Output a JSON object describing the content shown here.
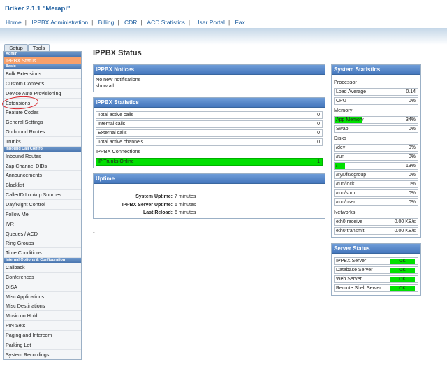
{
  "app": {
    "title": "Briker 2.1.1 \"Merapi\""
  },
  "topnav": {
    "items": [
      "Home",
      "IPPBX Administration",
      "Billing",
      "CDR",
      "ACD Statistics",
      "User Portal",
      "Fax"
    ],
    "separator": "|"
  },
  "sidebar": {
    "tabs": [
      "Setup",
      "Tools"
    ],
    "sections": [
      {
        "header": "Admin",
        "items": [
          "IPPBX Status"
        ]
      },
      {
        "header": "Basic",
        "items": [
          "Bulk Extensions",
          "Custom Contexts",
          "Device Auto Provisioning",
          "Extensions",
          "Feature Codes",
          "General Settings",
          "Outbound Routes",
          "Trunks"
        ]
      },
      {
        "header": "Inbound Call Control",
        "items": [
          "Inbound Routes",
          "Zap Channel DIDs",
          "Announcements",
          "Blacklist",
          "CallerID Lookup Sources",
          "Day/Night Control",
          "Follow Me",
          "IVR",
          "Queues / ACD",
          "Ring Groups",
          "Time Conditions"
        ]
      },
      {
        "header": "Internal Options & Configuration",
        "items": [
          "Callback",
          "Conferences",
          "DISA",
          "Misc Applications",
          "Misc Destinations",
          "Music on Hold",
          "PIN Sets",
          "Paging and Intercom",
          "Parking Lot",
          "System Recordings"
        ]
      }
    ],
    "active_item": "IPPBX Status",
    "highlighted_item": "Extensions"
  },
  "page": {
    "title": "IPPBX Status",
    "footnote": "-"
  },
  "notices": {
    "title": "IPPBX Notices",
    "lines": [
      "No new notifications",
      "show all"
    ]
  },
  "ippbx_stats": {
    "title": "IPPBX Statistics",
    "rows": [
      {
        "label": "Total active calls",
        "value": "0"
      },
      {
        "label": "Internal calls",
        "value": "0"
      },
      {
        "label": "External calls",
        "value": "0"
      },
      {
        "label": "Total active channels",
        "value": "0"
      }
    ],
    "connections_label": "IPPBX Connections",
    "connections": [
      {
        "label": "IP Trunks Online",
        "value": "1"
      }
    ]
  },
  "uptime": {
    "title": "Uptime",
    "rows": [
      {
        "label": "System Uptime:",
        "value": "7 minutes"
      },
      {
        "label": "IPPBX Server Uptime:",
        "value": "6 minutes"
      },
      {
        "label": "Last Reload:",
        "value": "6 minutes"
      }
    ]
  },
  "system_stats": {
    "title": "System Statistics",
    "processor_label": "Processor",
    "processor": [
      {
        "label": "Load Average",
        "value": "0.14"
      },
      {
        "label": "CPU",
        "value": "0%"
      }
    ],
    "memory_label": "Memory",
    "memory": [
      {
        "label": "App Memory",
        "value": "34%",
        "fill": 0.34
      },
      {
        "label": "Swap",
        "value": "0%",
        "fill": 0
      }
    ],
    "disks_label": "Disks",
    "disks": [
      {
        "label": "/dev",
        "value": "0%",
        "fill": 0
      },
      {
        "label": "/run",
        "value": "0%",
        "fill": 0
      },
      {
        "label": "/",
        "value": "13%",
        "fill": 0.13
      },
      {
        "label": "/sys/fs/cgroup",
        "value": "0%",
        "fill": 0
      },
      {
        "label": "/run/lock",
        "value": "0%",
        "fill": 0
      },
      {
        "label": "/run/shm",
        "value": "0%",
        "fill": 0
      },
      {
        "label": "/run/user",
        "value": "0%",
        "fill": 0
      }
    ],
    "networks_label": "Networks",
    "networks": [
      {
        "label": "eth0 receive",
        "value": "0.00 KB/s"
      },
      {
        "label": "eth0 transmit",
        "value": "0.00 KB/s"
      }
    ]
  },
  "server_status": {
    "title": "Server Status",
    "rows": [
      {
        "label": "IPPBX Server",
        "status": "OK"
      },
      {
        "label": "Database Server",
        "status": "OK"
      },
      {
        "label": "Web Server",
        "status": "OK"
      },
      {
        "label": "Remote Shell Server",
        "status": "OK"
      }
    ]
  },
  "colors": {
    "accent": "#1f5fa0",
    "panel_header": "#4f80c4",
    "ok": "#00e000",
    "active_menu": "#f8a06a",
    "highlight_circle": "#d8232a"
  }
}
